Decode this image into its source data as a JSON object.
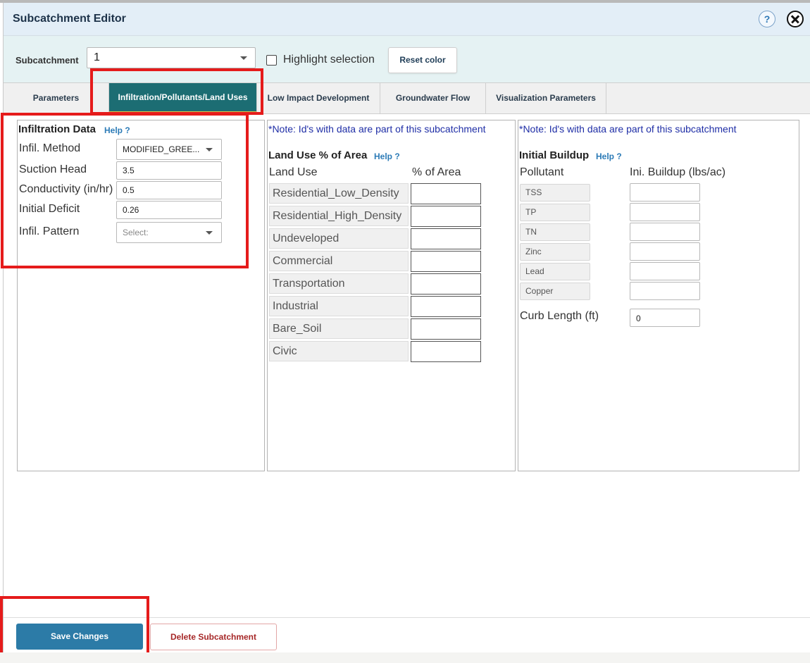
{
  "window": {
    "title": "Subcatchment Editor",
    "help_glyph": "?"
  },
  "subcatchment": {
    "label": "Subcatchment",
    "selected": "1",
    "highlight_label": "Highlight selection",
    "highlight_checked": false,
    "reset_label": "Reset color"
  },
  "tabs": [
    {
      "label": "Parameters",
      "active": false
    },
    {
      "label": "Infiltration/Pollutants/Land Uses",
      "active": true
    },
    {
      "label": "Low Impact Development",
      "active": false
    },
    {
      "label": "Groundwater Flow",
      "active": false
    },
    {
      "label": "Visualization Parameters",
      "active": false
    }
  ],
  "infiltration": {
    "heading": "Infiltration Data",
    "help": "Help ?",
    "method": {
      "label": "Infil. Method",
      "value": "MODIFIED_GREE..."
    },
    "suction_head": {
      "label": "Suction Head",
      "value": "3.5"
    },
    "conductivity": {
      "label": "Conductivity (in/hr)",
      "value": "0.5"
    },
    "initial_deficit": {
      "label": "Initial Deficit",
      "value": "0.26"
    },
    "pattern": {
      "label": "Infil. Pattern",
      "placeholder": "Select:"
    }
  },
  "land_use": {
    "note": "*Note: Id's with data are part of this subcatchment",
    "heading": "Land Use % of Area",
    "help": "Help ?",
    "col_name": "Land Use",
    "col_value": "% of Area",
    "rows": [
      {
        "name": "Residential_Low_Density",
        "value": ""
      },
      {
        "name": "Residential_High_Density",
        "value": ""
      },
      {
        "name": "Undeveloped",
        "value": ""
      },
      {
        "name": "Commercial",
        "value": ""
      },
      {
        "name": "Transportation",
        "value": ""
      },
      {
        "name": "Industrial",
        "value": ""
      },
      {
        "name": "Bare_Soil",
        "value": ""
      },
      {
        "name": "Civic",
        "value": ""
      }
    ]
  },
  "buildup": {
    "note": "*Note: Id's with data are part of this subcatchment",
    "heading": "Initial Buildup",
    "help": "Help ?",
    "col_name": "Pollutant",
    "col_value": "Ini. Buildup (lbs/ac)",
    "rows": [
      {
        "name": "TSS",
        "value": ""
      },
      {
        "name": "TP",
        "value": ""
      },
      {
        "name": "TN",
        "value": ""
      },
      {
        "name": "Zinc",
        "value": ""
      },
      {
        "name": "Lead",
        "value": ""
      },
      {
        "name": "Copper",
        "value": ""
      }
    ],
    "curb_label": "Curb Length (ft)",
    "curb_value": "0"
  },
  "footer": {
    "save_label": "Save Changes",
    "delete_label": "Delete Subcatchment"
  },
  "colors": {
    "accent": "#1c6d73",
    "primary_button": "#2c7ba7",
    "highlight_box": "#e51b1b",
    "danger_text": "#a62727"
  }
}
